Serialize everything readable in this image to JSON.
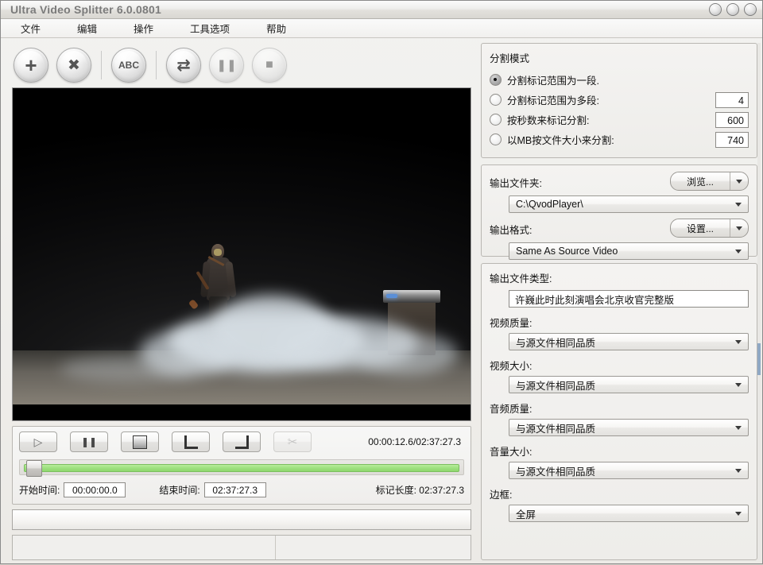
{
  "window": {
    "title": "Ultra Video Splitter 6.0.0801",
    "controls": [
      "minimize",
      "maximize",
      "close"
    ]
  },
  "menu": {
    "items": [
      {
        "label": "文件"
      },
      {
        "label": "编辑"
      },
      {
        "label": "操作"
      },
      {
        "label": "工具选项"
      },
      {
        "label": "帮助"
      }
    ]
  },
  "toolbar": {
    "buttons": [
      {
        "name": "add-file",
        "glyph": "+"
      },
      {
        "name": "remove-file",
        "glyph": "✖"
      },
      {
        "name": "rename",
        "glyph": "ABC"
      },
      {
        "name": "convert",
        "glyph": "⇄"
      },
      {
        "name": "pause",
        "glyph": "❚❚"
      },
      {
        "name": "stop",
        "glyph": "■"
      }
    ]
  },
  "player": {
    "buttons": [
      {
        "name": "play",
        "glyph": "▷"
      },
      {
        "name": "pause",
        "glyph": "❚❚"
      },
      {
        "name": "stop",
        "glyph": "▬"
      },
      {
        "name": "mark-in",
        "glyph": "L"
      },
      {
        "name": "mark-out",
        "glyph": "⌐"
      },
      {
        "name": "cut",
        "glyph": "✂"
      }
    ],
    "time_display": "00:00:12.6/02:37:27.3",
    "start_label": "开始时间:",
    "start_value": "00:00:00.0",
    "end_label": "结束时间:",
    "end_value": "02:37:27.3",
    "mark_length": "标记长度: 02:37:27.3",
    "progress_percent": 0.13,
    "track_color": "#9ee07f"
  },
  "split_mode": {
    "title": "分割模式",
    "options": [
      {
        "label": "分割标记范围为一段.",
        "checked": true,
        "value": null
      },
      {
        "label": "分割标记范围为多段:",
        "checked": false,
        "value": "4"
      },
      {
        "label": "按秒数来标记分割:",
        "checked": false,
        "value": "600"
      },
      {
        "label": "以MB按文件大小来分割:",
        "checked": false,
        "value": "740"
      }
    ]
  },
  "output": {
    "folder_label": "输出文件夹:",
    "browse_button": "浏览...",
    "folder_value": "C:\\QvodPlayer\\",
    "format_label": "输出格式:",
    "settings_button": "设置...",
    "format_value": "Same As Source Video"
  },
  "file_type": {
    "title": "输出文件类型:",
    "filename": "许巍此时此刻演唱会北京收官完整版",
    "fields": [
      {
        "label": "视频质量:",
        "value": "与源文件相同品质"
      },
      {
        "label": "视频大小:",
        "value": "与源文件相同品质"
      },
      {
        "label": "音频质量:",
        "value": "与源文件相同品质"
      },
      {
        "label": "音量大小:",
        "value": "与源文件相同品质"
      },
      {
        "label": "边框:",
        "value": "全屏"
      }
    ]
  },
  "video": {
    "description": "concert stage performer with fog and amplifier"
  }
}
